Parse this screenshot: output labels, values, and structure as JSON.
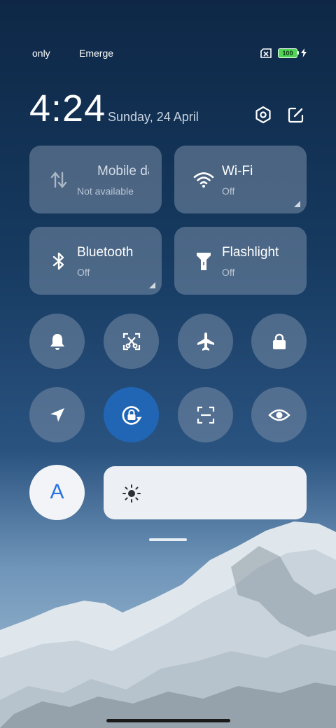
{
  "status_bar": {
    "left_text_1": "only",
    "left_text_2": "Emerge",
    "battery_level": "100"
  },
  "header": {
    "time": "4:24",
    "date": "Sunday, 24 April"
  },
  "tiles": [
    {
      "label": "Mobile data",
      "status": "Not available",
      "icon": "mobile-data-icon"
    },
    {
      "label": "Wi-Fi",
      "status": "Off",
      "icon": "wifi-icon"
    },
    {
      "label": "Bluetooth",
      "status": "Off",
      "icon": "bluetooth-icon"
    },
    {
      "label": "Flashlight",
      "status": "Off",
      "icon": "flashlight-icon"
    }
  ],
  "toggles_row1": [
    "bell-icon",
    "screenshot-icon",
    "airplane-icon",
    "lock-icon"
  ],
  "toggles_row2": [
    "location-icon",
    "rotation-lock-icon",
    "scanner-icon",
    "eye-icon"
  ],
  "auto_brightness_label": "A",
  "colors": {
    "tile_bg": "#788ca5",
    "active_toggle": "#2166b4",
    "auto_text": "#2a73e0"
  }
}
